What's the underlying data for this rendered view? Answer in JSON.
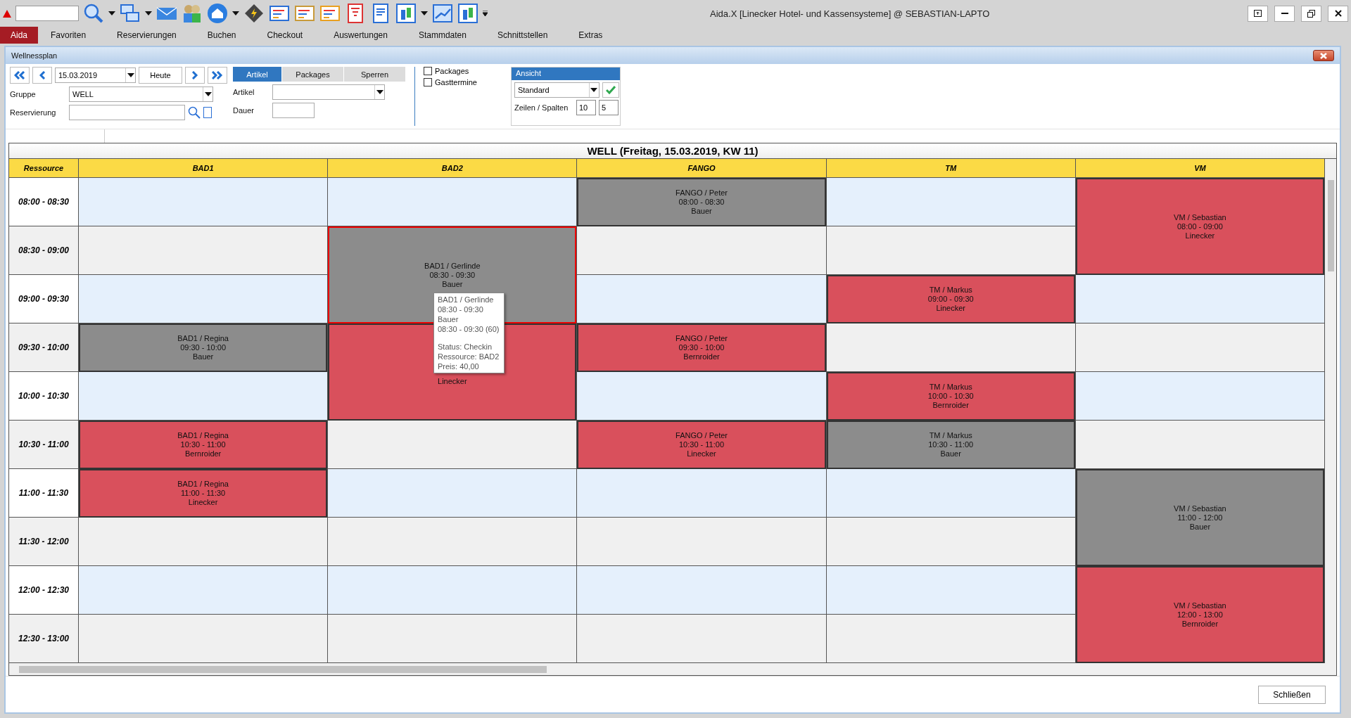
{
  "window": {
    "title": "Aida.X [Linecker Hotel- und Kassensysteme] @ SEBASTIAN-LAPTO"
  },
  "menu": [
    {
      "label": "Aida",
      "selected": true
    },
    {
      "label": "Favoriten",
      "selected": false
    },
    {
      "label": "Reservierungen",
      "selected": false
    },
    {
      "label": "Buchen",
      "selected": false
    },
    {
      "label": "Checkout",
      "selected": false
    },
    {
      "label": "Auswertungen",
      "selected": false
    },
    {
      "label": "Stammdaten",
      "selected": false
    },
    {
      "label": "Schnittstellen",
      "selected": false
    },
    {
      "label": "Extras",
      "selected": false
    }
  ],
  "dialog": {
    "title": "Wellnessplan",
    "date": "15.03.2019",
    "today_button": "Heute",
    "fields": [
      {
        "label": "Gruppe",
        "value": "WELL"
      },
      {
        "label": "Reservierung"
      }
    ],
    "tabs": [
      {
        "label": "Artikel",
        "selected": true
      },
      {
        "label": "Packages",
        "selected": false
      },
      {
        "label": "Sperren",
        "selected": false
      }
    ],
    "article_fields": [
      {
        "label": "Artikel"
      },
      {
        "label": "Dauer"
      }
    ],
    "checkboxes": [
      {
        "label": "Packages",
        "checked": false
      },
      {
        "label": "Gasttermine",
        "checked": false
      }
    ],
    "view": {
      "title": "Ansicht",
      "value": "Standard",
      "rows_cols_label": "Zeilen / Spalten",
      "rows": "10",
      "cols": "5"
    },
    "plan": {
      "title": "WELL (Freitag, 15.03.2019, KW 11)",
      "corner": "Ressource",
      "times": [
        "08:00 - 08:30",
        "08:30 - 09:00",
        "09:00 - 09:30",
        "09:30 - 10:00",
        "10:00 - 10:30",
        "10:30 - 11:00",
        "11:00 - 11:30",
        "11:30 - 12:00",
        "12:00 - 12:30",
        "12:30 - 13:00"
      ],
      "columns": [
        {
          "name": "BAD1",
          "cells": [
            {
              "kind": "free"
            },
            {
              "kind": "free"
            },
            {
              "kind": "free"
            },
            {
              "kind": "booking",
              "long": false,
              "color": "#8c8c8c",
              "selected": false,
              "lines": [
                "BAD1 / Regina",
                "09:30 - 10:00",
                "Bauer"
              ]
            },
            {
              "kind": "free"
            },
            {
              "kind": "booking",
              "long": false,
              "color": "#d9505c",
              "selected": false,
              "lines": [
                "BAD1 / Regina",
                "10:30 - 11:00",
                "Bernroider"
              ]
            },
            {
              "kind": "booking",
              "long": false,
              "color": "#d9505c",
              "selected": false,
              "lines": [
                "BAD1 / Regina",
                "11:00 - 11:30",
                "Linecker"
              ]
            },
            {
              "kind": "free"
            },
            {
              "kind": "free"
            },
            {
              "kind": "free"
            }
          ]
        },
        {
          "name": "BAD2",
          "cells": [
            {
              "kind": "free"
            },
            {
              "kind": "booking",
              "long": true,
              "color": "#8c8c8c",
              "selected": true,
              "lines": [
                "BAD1 / Gerlinde",
                "08:30 - 09:30",
                "Bauer"
              ]
            },
            {
              "kind": "booking",
              "long": true,
              "color": "#d9505c",
              "selected": false,
              "lines": [
                "Linecker"
              ]
            },
            {
              "kind": "free"
            },
            {
              "kind": "free"
            },
            {
              "kind": "free"
            },
            {
              "kind": "free"
            },
            {
              "kind": "free"
            }
          ]
        },
        {
          "name": "FANGO",
          "cells": [
            {
              "kind": "booking",
              "long": false,
              "color": "#8c8c8c",
              "selected": false,
              "lines": [
                "FANGO / Peter",
                "08:00 - 08:30",
                "Bauer"
              ]
            },
            {
              "kind": "free"
            },
            {
              "kind": "free"
            },
            {
              "kind": "booking",
              "long": false,
              "color": "#d9505c",
              "selected": false,
              "lines": [
                "FANGO / Peter",
                "09:30 - 10:00",
                "Bernroider"
              ]
            },
            {
              "kind": "free"
            },
            {
              "kind": "booking",
              "long": false,
              "color": "#d9505c",
              "selected": false,
              "lines": [
                "FANGO / Peter",
                "10:30 - 11:00",
                "Linecker"
              ]
            },
            {
              "kind": "free"
            },
            {
              "kind": "free"
            },
            {
              "kind": "free"
            },
            {
              "kind": "free"
            }
          ]
        },
        {
          "name": "TM",
          "cells": [
            {
              "kind": "free"
            },
            {
              "kind": "free"
            },
            {
              "kind": "booking",
              "long": false,
              "color": "#d9505c",
              "selected": false,
              "lines": [
                "TM / Markus",
                "09:00 - 09:30",
                "Linecker"
              ]
            },
            {
              "kind": "free"
            },
            {
              "kind": "booking",
              "long": false,
              "color": "#d9505c",
              "selected": false,
              "lines": [
                "TM / Markus",
                "10:00 - 10:30",
                "Bernroider"
              ]
            },
            {
              "kind": "booking",
              "long": false,
              "color": "#8c8c8c",
              "selected": false,
              "lines": [
                "TM / Markus",
                "10:30 - 11:00",
                "Bauer"
              ]
            },
            {
              "kind": "free"
            },
            {
              "kind": "free"
            },
            {
              "kind": "free"
            },
            {
              "kind": "free"
            }
          ]
        },
        {
          "name": "VM",
          "cells": [
            {
              "kind": "booking",
              "long": true,
              "color": "#d9505c",
              "selected": false,
              "lines": [
                "VM / Sebastian",
                "08:00 - 09:00",
                "Linecker"
              ]
            },
            {
              "kind": "free"
            },
            {
              "kind": "free"
            },
            {
              "kind": "free"
            },
            {
              "kind": "free"
            },
            {
              "kind": "booking",
              "long": true,
              "color": "#8c8c8c",
              "selected": false,
              "lines": [
                "VM / Sebastian",
                "11:00 - 12:00",
                "Bauer"
              ]
            },
            {
              "kind": "booking",
              "long": true,
              "color": "#d9505c",
              "selected": false,
              "lines": [
                "VM / Sebastian",
                "12:00 - 13:00",
                "Bernroider"
              ]
            }
          ]
        }
      ],
      "tooltip": {
        "lines": [
          "BAD1 / Gerlinde",
          "08:30 - 09:30",
          "Bauer",
          "08:30 - 09:30 (60)"
        ],
        "details": [
          "Status: Checkin",
          "Ressource: BAD2",
          "Preis: 40,00"
        ]
      }
    },
    "close_button": "Schließen"
  }
}
